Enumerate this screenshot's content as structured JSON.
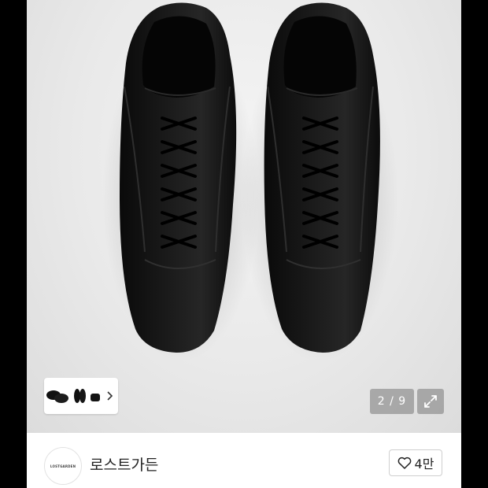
{
  "gallery": {
    "position": "2 / 9",
    "image_alt": "black leather lace-up sneakers, top view"
  },
  "thumbnails": {
    "count_visible": 3,
    "next_icon": "chevron-right-icon"
  },
  "store": {
    "logo_text": "LOSTGARDEN",
    "name": "로스트가든",
    "like_count": "4만",
    "like_icon": "heart-outline-icon"
  },
  "colors": {
    "background_outer": "#000000",
    "shoe": "#111111",
    "overlay": "#787878"
  }
}
